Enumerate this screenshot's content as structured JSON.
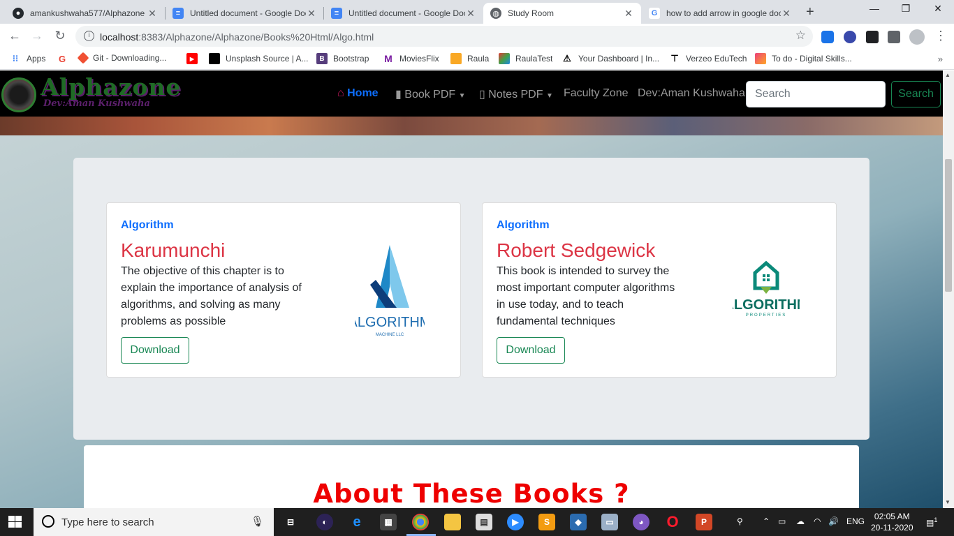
{
  "browser": {
    "tabs": [
      {
        "label": "amankushwaha577/Alphazone",
        "icon": "github-icon",
        "active": false
      },
      {
        "label": "Untitled document - Google Docs",
        "icon": "google-docs-icon",
        "active": false
      },
      {
        "label": "Untitled document - Google Docs",
        "icon": "google-docs-icon",
        "active": false
      },
      {
        "label": "Study Room",
        "icon": "globe-icon",
        "active": true
      },
      {
        "label": "how to add arrow in google docs",
        "icon": "google-icon",
        "active": false
      }
    ],
    "url_host": "localhost",
    "url_rest": ":8383/Alphazone/Alphazone/Books%20Html/Algo.html",
    "bookmarks": [
      {
        "label": "Apps",
        "icon": "apps-grid-icon"
      },
      {
        "label": "",
        "icon": "google-icon"
      },
      {
        "label": "Git - Downloading...",
        "icon": "git-icon"
      },
      {
        "label": "",
        "icon": "youtube-icon"
      },
      {
        "label": "Unsplash Source | A...",
        "icon": "unsplash-icon"
      },
      {
        "label": "Bootstrap",
        "icon": "bootstrap-icon"
      },
      {
        "label": "MoviesFlix",
        "icon": "moviesflix-icon"
      },
      {
        "label": "Raula",
        "icon": "raula-icon"
      },
      {
        "label": "RaulaTest",
        "icon": "raulatest-icon"
      },
      {
        "label": "Your Dashboard | In...",
        "icon": "dashboard-icon"
      },
      {
        "label": "Verzeo EduTech",
        "icon": "verzeo-icon"
      },
      {
        "label": "To do - Digital Skills...",
        "icon": "todo-icon"
      }
    ]
  },
  "site": {
    "brand": "Alphazone",
    "brand_sub": "Dev:Aman Kushwaha",
    "nav": {
      "home": "Home",
      "book_pdf": "Book PDF",
      "notes_pdf": "Notes PDF",
      "faculty": "Faculty Zone",
      "dev": "Dev:Aman Kushwaha"
    },
    "search_placeholder": "Search",
    "search_button": "Search"
  },
  "books": [
    {
      "category": "Algorithm",
      "title": "Karumunchi",
      "description": "The objective of this chapter is to explain the importance of analysis of algorithms, and solving as many problems as possible",
      "button": "Download",
      "logo_text": "ALGORITHM",
      "logo_sub": "MACHINE LLC"
    },
    {
      "category": "Algorithm",
      "title": "Robert Sedgewick",
      "description": "This book is intended to survey the most important computer algorithms in use today, and to teach fundamental techniques",
      "button": "Download",
      "logo_text": "ALGORITHM",
      "logo_sub": "PROPERTIES"
    }
  ],
  "about_heading": "About These Books ?",
  "taskbar": {
    "search_placeholder": "Type here to search",
    "lang": "ENG",
    "time": "02:05 AM",
    "date": "20-11-2020",
    "notifications": "1"
  }
}
